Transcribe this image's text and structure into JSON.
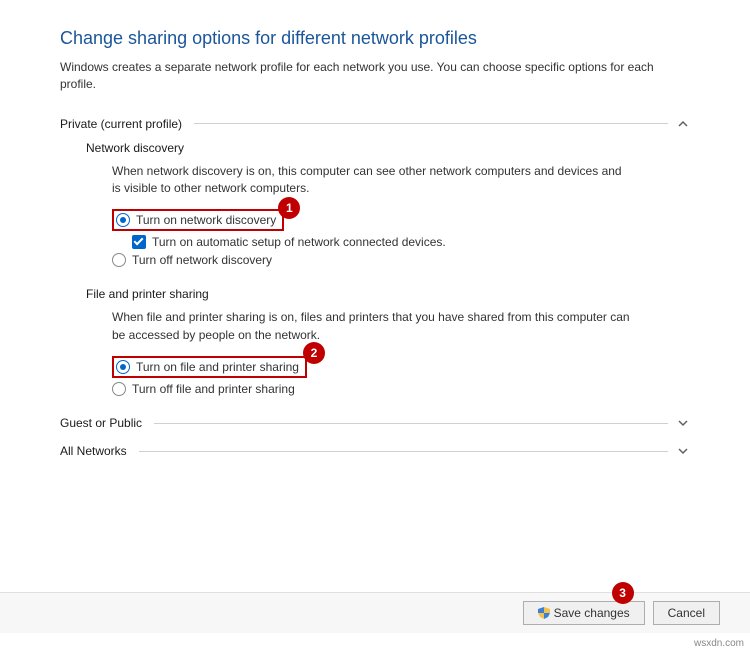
{
  "title": "Change sharing options for different network profiles",
  "description": "Windows creates a separate network profile for each network you use. You can choose specific options for each profile.",
  "profiles": {
    "private": {
      "label": "Private (current profile)",
      "expanded": true,
      "networkDiscovery": {
        "label": "Network discovery",
        "description": "When network discovery is on, this computer can see other network computers and devices and is visible to other network computers.",
        "optOn": "Turn on network discovery",
        "optAuto": "Turn on automatic setup of network connected devices.",
        "optOff": "Turn off network discovery"
      },
      "filePrinter": {
        "label": "File and printer sharing",
        "description": "When file and printer sharing is on, files and printers that you have shared from this computer can be accessed by people on the network.",
        "optOn": "Turn on file and printer sharing",
        "optOff": "Turn off file and printer sharing"
      }
    },
    "guest": {
      "label": "Guest or Public"
    },
    "all": {
      "label": "All Networks"
    }
  },
  "buttons": {
    "save": "Save changes",
    "cancel": "Cancel"
  },
  "annotations": {
    "b1": "1",
    "b2": "2",
    "b3": "3"
  },
  "watermark": "wsxdn.com"
}
